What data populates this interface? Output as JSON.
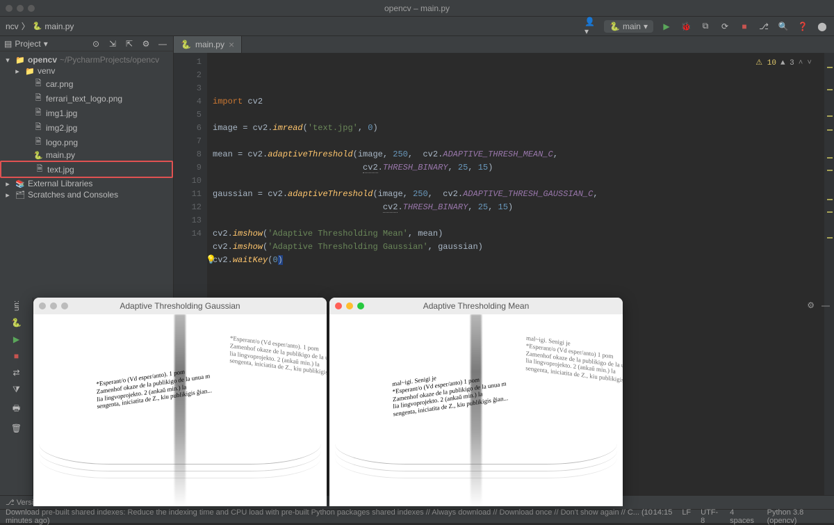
{
  "window_title": "opencv – main.py",
  "breadcrumb": {
    "project": "ncv",
    "file": "main.py"
  },
  "run_config": {
    "label": "main"
  },
  "sidebar": {
    "title": "Project",
    "root": {
      "name": "opencv",
      "hint": "~/PycharmProjects/opencv"
    },
    "items": [
      {
        "icon": "📁",
        "label": "venv",
        "indent": 1
      },
      {
        "icon": "🗎",
        "label": "car.png",
        "indent": 2
      },
      {
        "icon": "🗎",
        "label": "ferrari_text_logo.png",
        "indent": 2
      },
      {
        "icon": "🗎",
        "label": "img1.jpg",
        "indent": 2
      },
      {
        "icon": "🗎",
        "label": "img2.jpg",
        "indent": 2
      },
      {
        "icon": "🗎",
        "label": "logo.png",
        "indent": 2
      },
      {
        "icon": "🐍",
        "label": "main.py",
        "indent": 2
      },
      {
        "icon": "🗎",
        "label": "text.jpg",
        "indent": 2,
        "highlighted": true
      }
    ],
    "extras": [
      {
        "icon": "📚",
        "label": "External Libraries"
      },
      {
        "icon": "🗂",
        "label": "Scratches and Consoles"
      }
    ]
  },
  "tab": {
    "label": "main.py"
  },
  "problems": {
    "warn": "10",
    "m3": "3"
  },
  "code": {
    "lines": [
      {
        "n": 1,
        "tokens": [
          [
            "kw",
            "import"
          ],
          [
            "",
            " cv2"
          ]
        ]
      },
      {
        "n": 2,
        "tokens": [
          [
            "",
            ""
          ]
        ]
      },
      {
        "n": 3,
        "tokens": [
          [
            "",
            "image = cv2."
          ],
          [
            "fn",
            "imread"
          ],
          [
            "",
            "("
          ],
          [
            "str",
            "'text.jpg'"
          ],
          [
            "",
            ", "
          ],
          [
            "num",
            "0"
          ],
          [
            "",
            ")"
          ]
        ]
      },
      {
        "n": 4,
        "tokens": [
          [
            "",
            ""
          ]
        ]
      },
      {
        "n": 5,
        "tokens": [
          [
            "",
            "mean = cv2."
          ],
          [
            "fn",
            "adaptiveThreshold"
          ],
          [
            "",
            "(image, "
          ],
          [
            "num",
            "250"
          ],
          [
            "",
            ",  cv2."
          ],
          [
            "const",
            "ADAPTIVE_THRESH_MEAN_C"
          ],
          [
            "",
            ","
          ]
        ]
      },
      {
        "n": 6,
        "tokens": [
          [
            "",
            "                              "
          ],
          [
            "warn-u",
            "cv2"
          ],
          [
            "",
            "."
          ],
          [
            "const",
            "THRESH_BINARY"
          ],
          [
            "",
            ", "
          ],
          [
            "num",
            "25"
          ],
          [
            "",
            ", "
          ],
          [
            "num",
            "15"
          ],
          [
            "",
            ")"
          ]
        ]
      },
      {
        "n": 7,
        "tokens": [
          [
            "",
            ""
          ]
        ]
      },
      {
        "n": 8,
        "tokens": [
          [
            "",
            "gaussian = cv2."
          ],
          [
            "fn",
            "adaptiveThreshold"
          ],
          [
            "",
            "(image, "
          ],
          [
            "num",
            "250"
          ],
          [
            "",
            ",  cv2."
          ],
          [
            "const",
            "ADAPTIVE_THRESH_GAUSSIAN_C"
          ],
          [
            "",
            ","
          ]
        ]
      },
      {
        "n": 9,
        "tokens": [
          [
            "",
            "                                  "
          ],
          [
            "warn-u",
            "cv2"
          ],
          [
            "",
            "."
          ],
          [
            "const",
            "THRESH_BINARY"
          ],
          [
            "",
            ", "
          ],
          [
            "num",
            "25"
          ],
          [
            "",
            ", "
          ],
          [
            "num",
            "15"
          ],
          [
            "",
            ")"
          ]
        ]
      },
      {
        "n": 10,
        "tokens": [
          [
            "",
            ""
          ]
        ]
      },
      {
        "n": 11,
        "tokens": [
          [
            "",
            "cv2."
          ],
          [
            "fn",
            "imshow"
          ],
          [
            "",
            "("
          ],
          [
            "str",
            "'Adaptive Thresholding Mean'"
          ],
          [
            "",
            ", mean)"
          ]
        ]
      },
      {
        "n": 12,
        "tokens": [
          [
            "",
            "cv2."
          ],
          [
            "fn",
            "imshow"
          ],
          [
            "",
            "("
          ],
          [
            "str",
            "'Adaptive Thresholding Gaussian'"
          ],
          [
            "",
            ", gaussian)"
          ]
        ]
      },
      {
        "n": 13,
        "tokens": [
          [
            "",
            ""
          ]
        ],
        "bulb": true
      },
      {
        "n": 14,
        "tokens": [
          [
            "",
            "cv2."
          ],
          [
            "fn",
            "waitKey"
          ],
          [
            "",
            "("
          ],
          [
            "num",
            "0"
          ],
          [
            "bg",
            ")"
          ]
        ]
      }
    ]
  },
  "output_windows": [
    {
      "title": "Adaptive Thresholding Gaussian",
      "active": false,
      "sample_text": "*Esperant/o (Vd esper/anto). 1 pom\\nZamenhof okaze de la publikigo de la unua m\\nlia lingvoprojekto. 2 (ankaŭ min.) la\\nsengenta, iniciatita de Z., kiu publikigis ĝian..."
    },
    {
      "title": "Adaptive Thresholding Mean",
      "active": true,
      "sample_text": "mal~igi. Senigi je\\n*Esperant/o (Vd esper/anto) 1 pom\\nZamenhof okaze de la publikigo de la unua m\\nlia lingvoprojekto. 2 (ankaŭ min.) la\\nsengenta, iniciatita de Z., kiu publikigis ĝian..."
    }
  ],
  "version_bar": "Version",
  "status": {
    "left": "Download pre-built shared indexes: Reduce the indexing time and CPU load with pre-built Python packages shared indexes // Always download // Download once // Don't show again // C... (10 minutes ago)",
    "right": [
      "14:15",
      "LF",
      "UTF-8",
      "4 spaces",
      "Python 3.8 (opencv)"
    ]
  },
  "run_label": "un:"
}
